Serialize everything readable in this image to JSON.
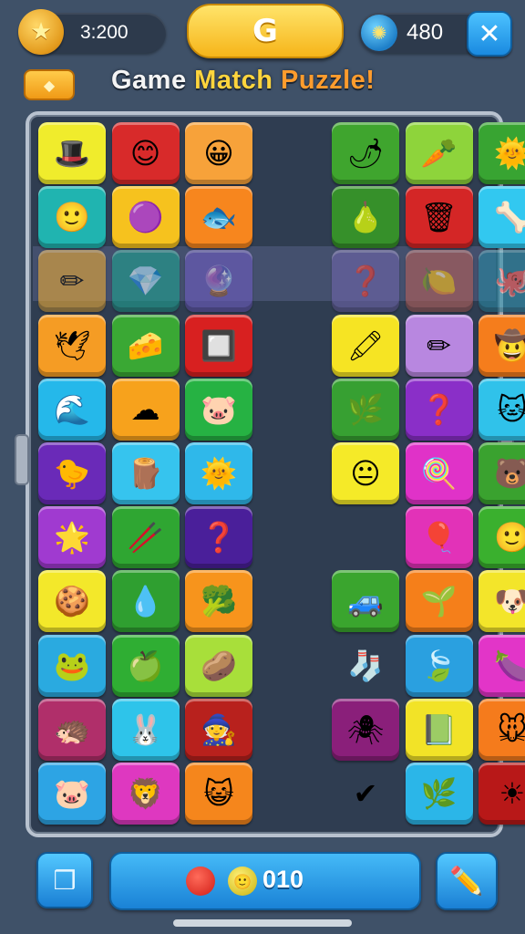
{
  "hud": {
    "coins": "3:200",
    "gems": "480",
    "center_glyph": "G",
    "close_glyph": "✕"
  },
  "title": {
    "part1": "Game ",
    "part2": "Match ",
    "part3": "Puzzle!"
  },
  "bottom": {
    "score": "010"
  },
  "tiles": [
    {
      "r": 0,
      "c": 0,
      "color": "#f0ec2c",
      "icon": "🎩",
      "name": "hat-face-icon"
    },
    {
      "r": 0,
      "c": 1,
      "color": "#d82a2a",
      "icon": "😊",
      "name": "curly-face-icon"
    },
    {
      "r": 0,
      "c": 2,
      "color": "#f7a23a",
      "icon": "😀",
      "name": "purple-hair-face-icon"
    },
    {
      "r": 0,
      "c": 4,
      "color": "#3fa52e",
      "icon": "🌶",
      "name": "red-chili-icon"
    },
    {
      "r": 0,
      "c": 5,
      "color": "#8ed43b",
      "icon": "🥕",
      "name": "cone-icon"
    },
    {
      "r": 0,
      "c": 6,
      "color": "#38a432",
      "icon": "🌞",
      "name": "sun-face-icon"
    },
    {
      "r": 1,
      "c": 0,
      "color": "#20b4b0",
      "icon": "🙂",
      "name": "yellow-face-icon"
    },
    {
      "r": 1,
      "c": 1,
      "color": "#f6c21e",
      "icon": "🟣",
      "name": "pink-ball-icon"
    },
    {
      "r": 1,
      "c": 2,
      "color": "#f7861e",
      "icon": "🐟",
      "name": "fish-icon"
    },
    {
      "r": 1,
      "c": 4,
      "color": "#36902a",
      "icon": "🍐",
      "name": "pear-icon"
    },
    {
      "r": 1,
      "c": 5,
      "color": "#d42626",
      "icon": "🗑",
      "name": "trash-can-icon"
    },
    {
      "r": 1,
      "c": 6,
      "color": "#32c8f0",
      "icon": "🦴",
      "name": "bone-icon"
    },
    {
      "r": 2,
      "c": 0,
      "color": "#e6a83a",
      "icon": "✏",
      "name": "crayon-icon",
      "dim": true
    },
    {
      "r": 2,
      "c": 1,
      "color": "#1f9f8f",
      "icon": "💎",
      "name": "blue-crystal-icon",
      "dim": true
    },
    {
      "r": 2,
      "c": 2,
      "color": "#6d5cc0",
      "icon": "🔮",
      "name": "purple-crystal-icon",
      "dim": true
    },
    {
      "r": 2,
      "c": 4,
      "color": "#6d64a8",
      "icon": "❓",
      "name": "hook-icon",
      "dim": true
    },
    {
      "r": 2,
      "c": 5,
      "color": "#b2605a",
      "icon": "🍋",
      "name": "lemon-icon",
      "dim": true
    },
    {
      "r": 2,
      "c": 6,
      "color": "#2a86a0",
      "icon": "🐙",
      "name": "octopus-icon",
      "dim": true
    },
    {
      "r": 3,
      "c": 0,
      "color": "#f59c24",
      "icon": "🕊",
      "name": "bird-icon"
    },
    {
      "r": 3,
      "c": 1,
      "color": "#3aa834",
      "icon": "🧀",
      "name": "cheese-icon"
    },
    {
      "r": 3,
      "c": 2,
      "color": "#d82020",
      "icon": "🔲",
      "name": "square-frame-icon"
    },
    {
      "r": 3,
      "c": 4,
      "color": "#f6e423",
      "icon": "🖍",
      "name": "red-crayon-icon"
    },
    {
      "r": 3,
      "c": 5,
      "color": "#b887e0",
      "icon": "✏",
      "name": "pencil-icon"
    },
    {
      "r": 3,
      "c": 6,
      "color": "#f57d1c",
      "icon": "🤠",
      "name": "cowboy-face-icon"
    },
    {
      "r": 4,
      "c": 0,
      "color": "#25b8ea",
      "icon": "🌊",
      "name": "wave-icon"
    },
    {
      "r": 4,
      "c": 1,
      "color": "#f7a21c",
      "icon": "☁",
      "name": "pink-cloud-icon"
    },
    {
      "r": 4,
      "c": 2,
      "color": "#26b243",
      "icon": "🐷",
      "name": "pig-face-icon"
    },
    {
      "r": 4,
      "c": 4,
      "color": "#37a032",
      "icon": "🌿",
      "name": "leaf-icon"
    },
    {
      "r": 4,
      "c": 5,
      "color": "#8a2fc8",
      "icon": "❓",
      "name": "purple-hook-icon"
    },
    {
      "r": 4,
      "c": 6,
      "color": "#30c2ea",
      "icon": "🐱",
      "name": "cat-face-icon"
    },
    {
      "r": 5,
      "c": 0,
      "color": "#6a2ab8",
      "icon": "🐤",
      "name": "chick-icon"
    },
    {
      "r": 5,
      "c": 1,
      "color": "#36c4ee",
      "icon": "🪵",
      "name": "wood-log-icon"
    },
    {
      "r": 5,
      "c": 2,
      "color": "#2fb8ea",
      "icon": "🌞",
      "name": "small-sun-icon"
    },
    {
      "r": 5,
      "c": 4,
      "color": "#f5ea28",
      "icon": "😐",
      "name": "orange-face-icon"
    },
    {
      "r": 5,
      "c": 5,
      "color": "#e032c8",
      "icon": "🍭",
      "name": "popsicle-icon"
    },
    {
      "r": 5,
      "c": 6,
      "color": "#3aa22f",
      "icon": "🐻",
      "name": "bear-face-icon"
    },
    {
      "r": 6,
      "c": 0,
      "color": "#a03ad0",
      "icon": "🌟",
      "name": "star-face-icon"
    },
    {
      "r": 6,
      "c": 1,
      "color": "#2fa632",
      "icon": "🥢",
      "name": "sticks-icon"
    },
    {
      "r": 6,
      "c": 2,
      "color": "#4a1f9a",
      "icon": "❓",
      "name": "blue-hook-icon"
    },
    {
      "r": 6,
      "c": 5,
      "color": "#e232b8",
      "icon": "🎈",
      "name": "balloon-icon"
    },
    {
      "r": 6,
      "c": 6,
      "color": "#3ab02e",
      "icon": "🙂",
      "name": "green-face-icon"
    },
    {
      "r": 7,
      "c": 0,
      "color": "#f3e82a",
      "icon": "🍪",
      "name": "cookie-icon"
    },
    {
      "r": 7,
      "c": 1,
      "color": "#2f9f30",
      "icon": "💧",
      "name": "blue-drop-icon"
    },
    {
      "r": 7,
      "c": 2,
      "color": "#f7941c",
      "icon": "🥦",
      "name": "broccoli-icon"
    },
    {
      "r": 7,
      "c": 4,
      "color": "#3aa52e",
      "icon": "🚙",
      "name": "car-icon"
    },
    {
      "r": 7,
      "c": 5,
      "color": "#f57f1a",
      "icon": "🌱",
      "name": "sprout-icon"
    },
    {
      "r": 7,
      "c": 6,
      "color": "#f3e52a",
      "icon": "🐶",
      "name": "dog-face-icon"
    },
    {
      "r": 8,
      "c": 0,
      "color": "#2aaae0",
      "icon": "🐸",
      "name": "frog-icon"
    },
    {
      "r": 8,
      "c": 1,
      "color": "#2fae33",
      "icon": "🍏",
      "name": "apple-icon"
    },
    {
      "r": 8,
      "c": 2,
      "color": "#a8df3a",
      "icon": "🥔",
      "name": "stone-icon"
    },
    {
      "r": 8,
      "c": 5,
      "color": "#2aa0e0",
      "icon": "🍃",
      "name": "green-leaf-icon"
    },
    {
      "r": 8,
      "c": 6,
      "color": "#e235c8",
      "icon": "🍆",
      "name": "eggplant-icon"
    },
    {
      "r": 9,
      "c": 0,
      "color": "#b02f6a",
      "icon": "🦔",
      "name": "hedgehog-icon"
    },
    {
      "r": 9,
      "c": 1,
      "color": "#2ec4ea",
      "icon": "🐰",
      "name": "bunny-icon"
    },
    {
      "r": 9,
      "c": 2,
      "color": "#b8211d",
      "icon": "🧙",
      "name": "gnome-icon"
    },
    {
      "r": 9,
      "c": 4,
      "color": "#8a1f7a",
      "icon": "🕷",
      "name": "spider-sun-icon"
    },
    {
      "r": 9,
      "c": 5,
      "color": "#f2e327",
      "icon": "📗",
      "name": "notepad-icon"
    },
    {
      "r": 9,
      "c": 6,
      "color": "#f57b1c",
      "icon": "🐭",
      "name": "mouse-face-icon"
    },
    {
      "r": 10,
      "c": 0,
      "color": "#2da4e4",
      "icon": "🐷",
      "name": "pink-pig-icon"
    },
    {
      "r": 10,
      "c": 1,
      "color": "#de38c0",
      "icon": "🦁",
      "name": "lion-face-icon"
    },
    {
      "r": 10,
      "c": 2,
      "color": "#f5861c",
      "icon": "😺",
      "name": "purple-cat-icon"
    },
    {
      "r": 10,
      "c": 5,
      "color": "#2bb6e8",
      "icon": "🌿",
      "name": "green-leaf-tile-icon"
    },
    {
      "r": 10,
      "c": 6,
      "color": "#b81818",
      "icon": "☀",
      "name": "sun-icon"
    }
  ],
  "loose_items": [
    {
      "icon": "🧦",
      "name": "sock-icon",
      "r": 8,
      "c": 4
    },
    {
      "icon": "✔",
      "name": "checkmark-icon",
      "r": 10,
      "c": 4
    }
  ]
}
